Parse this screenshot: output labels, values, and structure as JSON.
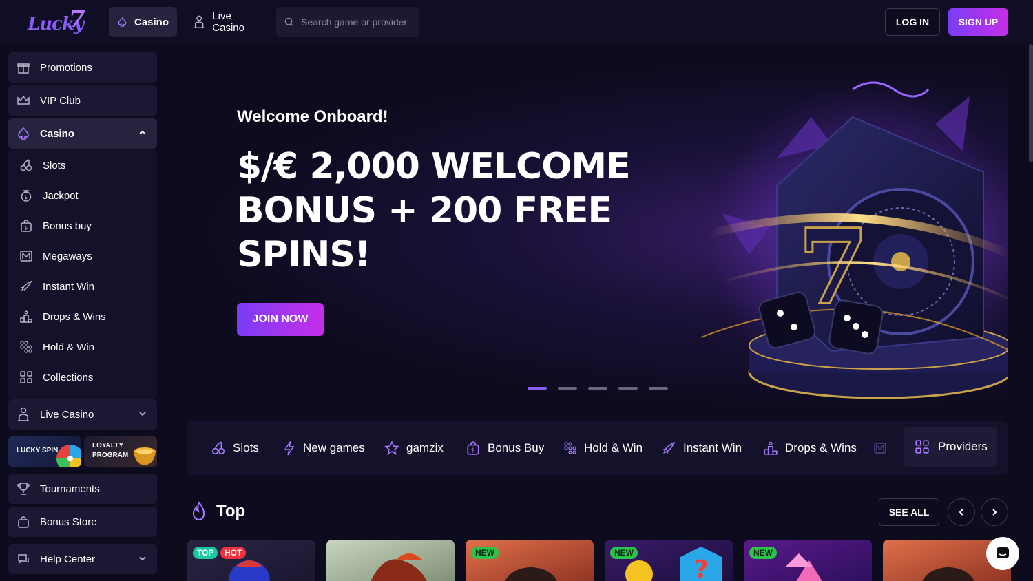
{
  "header": {
    "logo_text": "Lucky",
    "logo_seven": "7",
    "nav_casino": "Casino",
    "nav_live_casino": "Live Casino",
    "search_placeholder": "Search game or provider",
    "login": "LOG IN",
    "signup": "SIGN UP"
  },
  "sidebar": {
    "promotions": "Promotions",
    "vip": "VIP Club",
    "casino": "Casino",
    "casino_items": [
      "Slots",
      "Jackpot",
      "Bonus buy",
      "Megaways",
      "Instant Win",
      "Drops & Wins",
      "Hold & Win",
      "Collections"
    ],
    "live_casino": "Live Casino",
    "lucky_spin": "LUCKY SPIN",
    "loyalty_1": "LOYALTY",
    "loyalty_2": "PROGRAM",
    "tournaments": "Tournaments",
    "bonus_store": "Bonus Store",
    "help_center": "Help Center"
  },
  "hero": {
    "subtitle": "Welcome Onboard!",
    "title": "$/€ 2,000 WELCOME BONUS + 200 FREE SPINS!",
    "cta": "JOIN NOW",
    "slides_total": 5,
    "slide_active": 1
  },
  "categories": {
    "items": [
      "Slots",
      "New games",
      "gamzix",
      "Bonus Buy",
      "Hold & Win",
      "Instant Win",
      "Drops & Wins"
    ],
    "providers": "Providers"
  },
  "top_section": {
    "title": "Top",
    "see_all": "SEE ALL",
    "cards": [
      {
        "badges": [
          "TOP",
          "HOT"
        ]
      },
      {
        "badges": []
      },
      {
        "badges": [
          "NEW"
        ]
      },
      {
        "badges": [
          "NEW"
        ]
      },
      {
        "badges": [
          "NEW"
        ]
      },
      {
        "badges": []
      }
    ]
  },
  "colors": {
    "accent_start": "#7a3df5",
    "accent_end": "#c72ee8",
    "bg": "#0d0b1e",
    "badge_top": "#19c8a0",
    "badge_hot": "#f0313e",
    "badge_new": "#2bc34a"
  }
}
